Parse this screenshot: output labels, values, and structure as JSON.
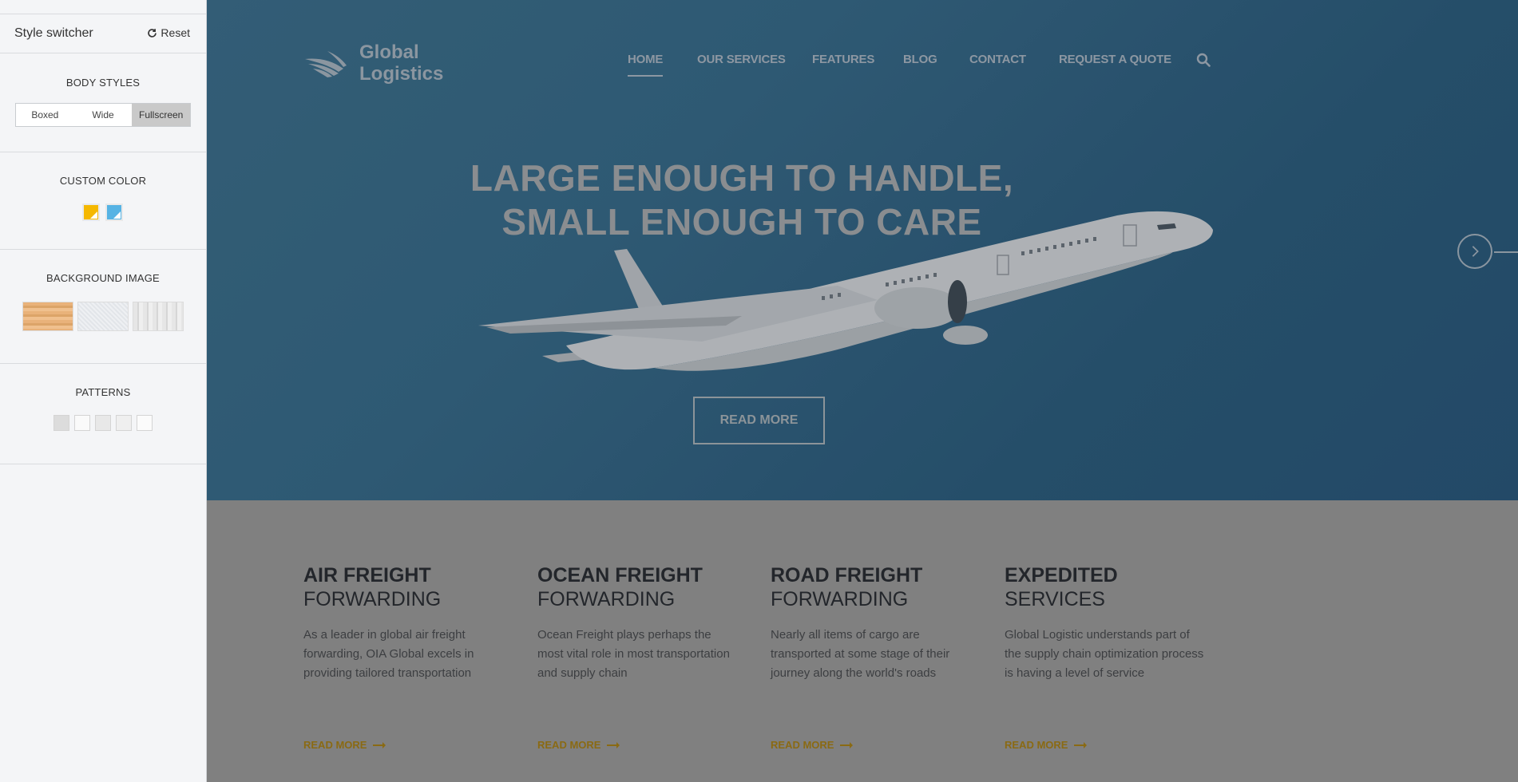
{
  "switcher": {
    "title": "Style switcher",
    "reset_label": "Reset",
    "body_styles_heading": "BODY STYLES",
    "body_styles": [
      "Boxed",
      "Wide",
      "Fullscreen"
    ],
    "body_styles_selected": "Fullscreen",
    "custom_color_heading": "CUSTOM COLOR",
    "colors": [
      "#f5b800",
      "#56b3e4"
    ],
    "background_image_heading": "BACKGROUND IMAGE",
    "background_images": [
      "wood-texture",
      "light-grid-texture",
      "whitewood-texture"
    ],
    "patterns_heading": "PATTERNS",
    "patterns": [
      "pattern-1",
      "pattern-2",
      "pattern-3",
      "pattern-4",
      "pattern-5"
    ]
  },
  "header": {
    "logo_line1": "Global",
    "logo_line2": "Logistics",
    "nav": [
      "HOME",
      "OUR SERVICES",
      "FEATURES",
      "BLOG",
      "CONTACT",
      "REQUEST A QUOTE"
    ],
    "nav_active": "HOME",
    "search_icon": "search-icon"
  },
  "hero": {
    "headline_line1": "LARGE ENOUGH TO HANDLE,",
    "headline_line2": "SMALL ENOUGH TO CARE",
    "cta": "READ MORE",
    "next_icon": "chevron-right-icon"
  },
  "services": [
    {
      "title": "AIR FREIGHT",
      "subtitle": "FORWARDING",
      "description": "As a leader in global air freight forwarding, OIA Global excels in providing tailored transportation",
      "link": "READ MORE"
    },
    {
      "title": "OCEAN FREIGHT",
      "subtitle": "FORWARDING",
      "description": "Ocean Freight plays perhaps the most vital role in most transportation and supply chain",
      "link": "READ MORE"
    },
    {
      "title": "ROAD FREIGHT",
      "subtitle": "FORWARDING",
      "description": "Nearly all items of cargo are transported at some stage of their journey along the world's roads",
      "link": "READ MORE"
    },
    {
      "title": "EXPEDITED",
      "subtitle": "SERVICES",
      "description": "Global Logistic understands part of the supply chain optimization process is having a level of service",
      "link": "READ MORE"
    }
  ]
}
